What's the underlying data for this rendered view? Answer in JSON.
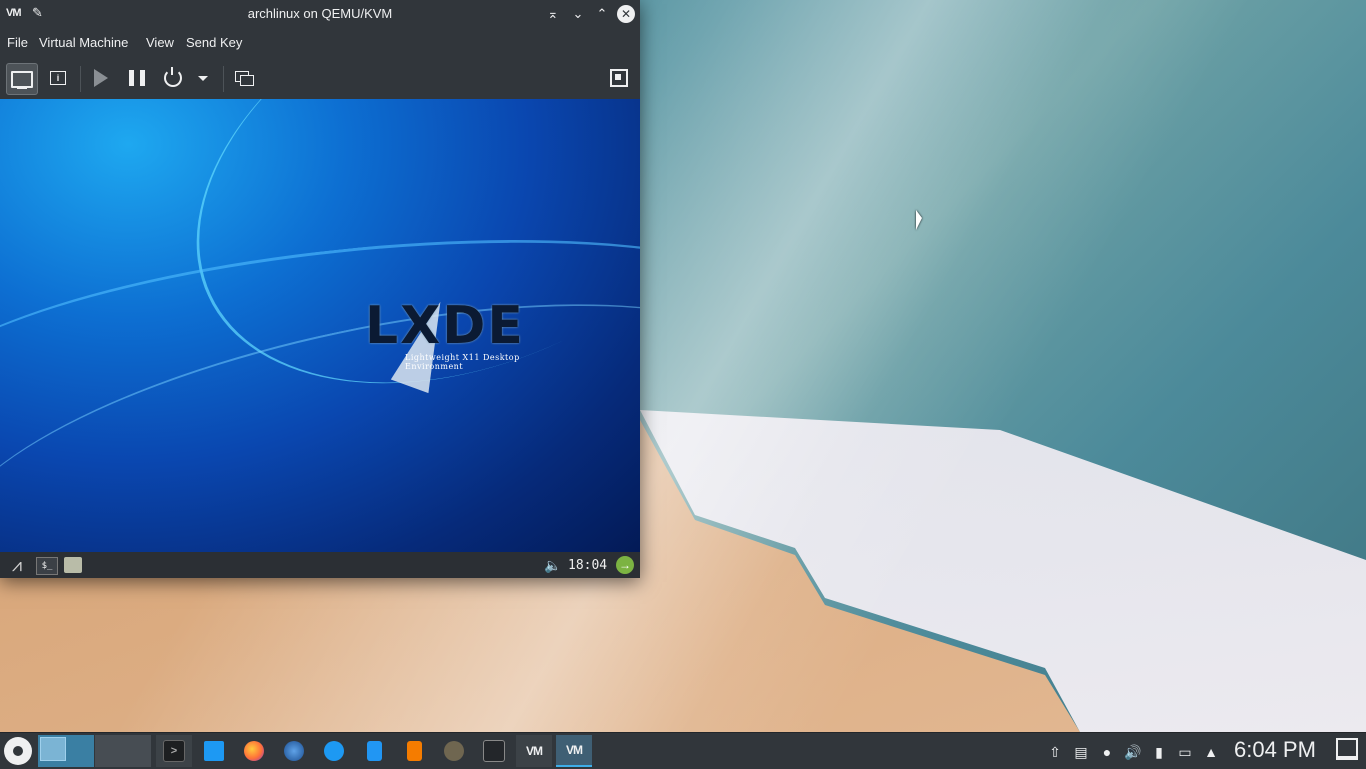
{
  "window": {
    "title": "archlinux on QEMU/KVM",
    "app_icon_label": "VM"
  },
  "menubar": [
    "File",
    "Virtual Machine",
    "View",
    "Send Key"
  ],
  "toolbar": {
    "buttons": [
      "console-view",
      "details-view",
      "run",
      "pause",
      "shutdown",
      "shutdown-menu",
      "snapshots",
      "fullscreen"
    ]
  },
  "guest": {
    "logo_text": "LXDE",
    "logo_tagline": "Lightweight X11 Desktop Environment",
    "panel": {
      "terminal_label": "$_",
      "clock": "18:04"
    }
  },
  "taskbar": {
    "tasks": [
      {
        "name": "konsole",
        "label": ">"
      },
      {
        "name": "dolphin",
        "label": ""
      },
      {
        "name": "firefox",
        "label": ""
      },
      {
        "name": "thunderbird",
        "label": ""
      },
      {
        "name": "kget",
        "label": ""
      },
      {
        "name": "writer",
        "label": ""
      },
      {
        "name": "impress",
        "label": ""
      },
      {
        "name": "gimp",
        "label": ""
      },
      {
        "name": "system-settings",
        "label": ""
      },
      {
        "name": "virt-manager",
        "label": "VM"
      },
      {
        "name": "virt-viewer",
        "label": "VM"
      }
    ],
    "clock": "6:04 PM"
  },
  "colors": {
    "panel_bg": "#31363b",
    "accent": "#3daee9",
    "text": "#eff0f1"
  }
}
